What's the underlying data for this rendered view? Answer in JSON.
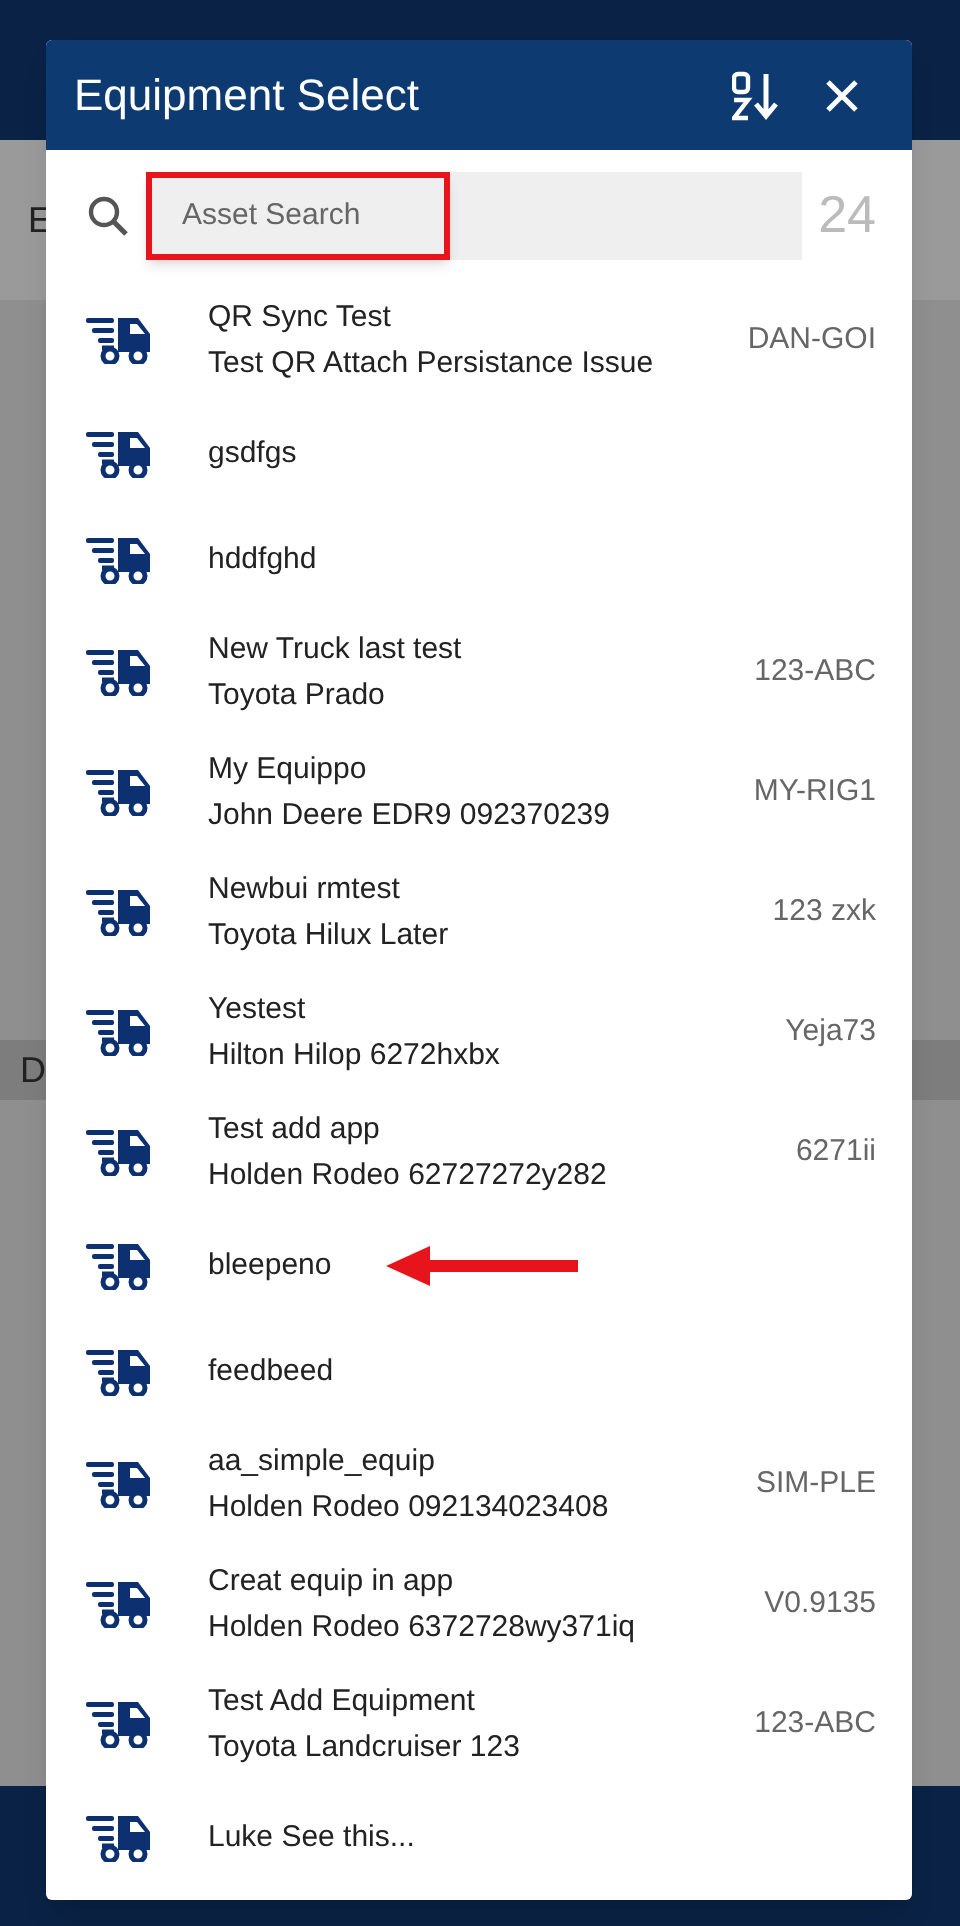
{
  "background": {
    "labels": [
      "E",
      "D"
    ]
  },
  "dialog": {
    "title": "Equipment Select",
    "search": {
      "placeholder": "Asset Search",
      "highlighted": true
    },
    "count": "24",
    "items": [
      {
        "name": "QR Sync Test",
        "model": "Test QR Attach Persistance Issue",
        "code": "DAN-GOI",
        "pointed": false
      },
      {
        "name": "gsdfgs",
        "pointed": false
      },
      {
        "name": "hddfghd",
        "pointed": false
      },
      {
        "name": "New Truck last test",
        "model": "Toyota Prado",
        "code": "123-ABC",
        "pointed": false
      },
      {
        "name": "My Equippo",
        "model": "John Deere EDR9 092370239",
        "code": "MY-RIG1",
        "pointed": false
      },
      {
        "name": "Newbui rmtest",
        "model": "Toyota Hilux Later",
        "code": "123 zxk",
        "pointed": false
      },
      {
        "name": "Yestest",
        "model": "Hilton Hilop 6272hxbx",
        "code": "Yeja73",
        "pointed": false
      },
      {
        "name": "Test add app",
        "model": "Holden Rodeo 62727272y282",
        "code": "6271ii",
        "pointed": false
      },
      {
        "name": "bleepeno",
        "pointed": true
      },
      {
        "name": "feedbeed",
        "pointed": false
      },
      {
        "name": "aa_simple_equip",
        "model": "Holden Rodeo 092134023408",
        "code": "SIM-PLE",
        "pointed": false
      },
      {
        "name": "Creat equip in app",
        "model": "Holden Rodeo 6372728wy371iq",
        "code": "V0.9135",
        "pointed": false
      },
      {
        "name": "Test Add Equipment",
        "model": "Toyota Landcruiser 123",
        "code": "123-ABC",
        "pointed": false
      },
      {
        "name": "Luke See this...",
        "pointed": false
      }
    ]
  }
}
